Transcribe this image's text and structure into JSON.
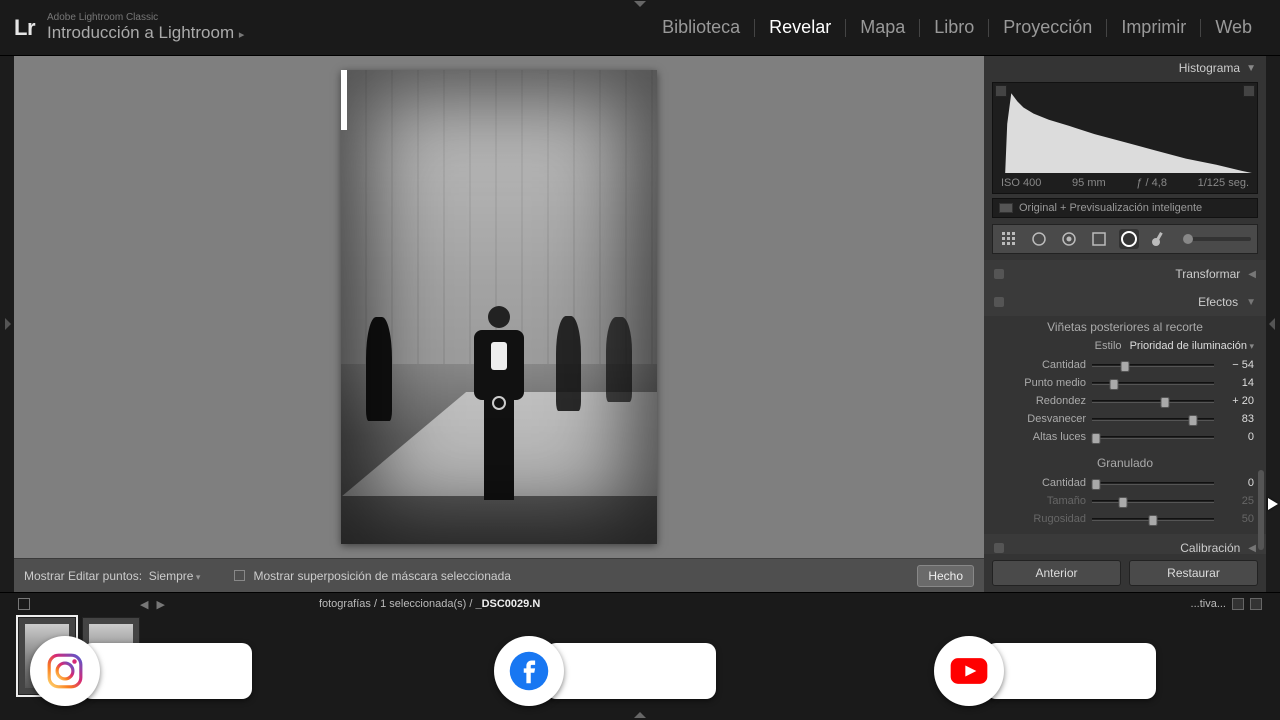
{
  "app": {
    "suite": "Adobe Lightroom Classic",
    "title": "Introducción a Lightroom",
    "logo": "Lr"
  },
  "modules": {
    "items": [
      "Biblioteca",
      "Revelar",
      "Mapa",
      "Libro",
      "Proyección",
      "Imprimir",
      "Web"
    ],
    "active": "Revelar"
  },
  "histogram": {
    "title": "Histograma",
    "iso": "ISO 400",
    "focal": "95 mm",
    "aperture": "ƒ / 4,8",
    "shutter": "1/125 seg.",
    "note": "Original + Previsualización inteligente"
  },
  "toolstrip": {
    "tools": [
      "crop-icon",
      "spot-icon",
      "redeye-icon",
      "grad-icon",
      "radial-icon",
      "brush-icon"
    ],
    "active": "radial-icon"
  },
  "sections": {
    "transform": "Transformar",
    "effects": "Efectos",
    "calibration": "Calibración"
  },
  "effects": {
    "vignette_header": "Viñetas posteriores al recorte",
    "style_label": "Estilo",
    "style_value": "Prioridad de iluminación",
    "sliders": [
      {
        "label": "Cantidad",
        "value": "− 54",
        "pos": 27
      },
      {
        "label": "Punto medio",
        "value": "14",
        "pos": 18
      },
      {
        "label": "Redondez",
        "value": "+ 20",
        "pos": 60
      },
      {
        "label": "Desvanecer",
        "value": "83",
        "pos": 83
      },
      {
        "label": "Altas luces",
        "value": "0",
        "pos": 3
      }
    ],
    "grain_header": "Granulado",
    "grain": [
      {
        "label": "Cantidad",
        "value": "0",
        "pos": 3,
        "dim": false
      },
      {
        "label": "Tamaño",
        "value": "25",
        "pos": 25,
        "dim": true
      },
      {
        "label": "Rugosidad",
        "value": "50",
        "pos": 50,
        "dim": true
      }
    ]
  },
  "panel_buttons": {
    "prev": "Anterior",
    "reset": "Restaurar"
  },
  "canvas_bar": {
    "edit_points_label": "Mostrar Editar puntos:",
    "edit_points_value": "Siempre",
    "mask_overlay": "Mostrar superposición de máscara seleccionada",
    "done": "Hecho"
  },
  "filmstrip": {
    "count_text": "fotografías / 1 seleccionada(s) /",
    "filename": "_DSC0029.N",
    "filter_text": "...tiva..."
  },
  "social": {
    "instagram": "instagram-icon",
    "facebook": "facebook-icon",
    "youtube": "youtube-icon"
  }
}
